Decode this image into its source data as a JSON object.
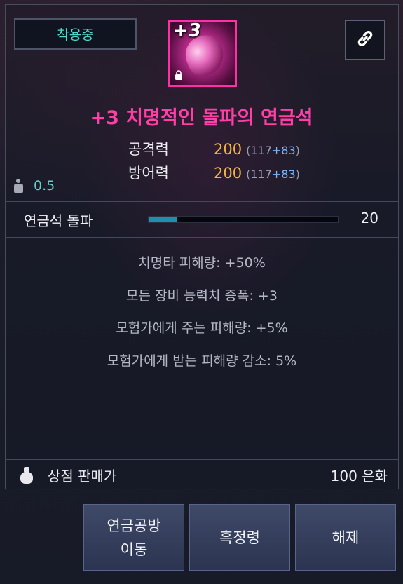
{
  "equip_status": "착용중",
  "item": {
    "enhance_level": "+3",
    "title": "+3 치명적인 돌파의 연금석",
    "rarity_color": "#ff2fa6"
  },
  "icons": {
    "link": "link-icon",
    "lock": "lock-icon",
    "weight": "weight-icon",
    "bag": "money-bag-icon"
  },
  "stats": [
    {
      "label": "공격력",
      "value": "200",
      "base": "117",
      "bonus": "+83"
    },
    {
      "label": "방어력",
      "value": "200",
      "base": "117",
      "bonus": "+83"
    }
  ],
  "weight": "0.5",
  "breakthrough": {
    "label": "연금석 돌파",
    "value": "20",
    "progress_fraction": 0.15
  },
  "effects": [
    "치명타 피해량: +50%",
    "모든 장비 능력치 증폭: +3",
    "모험가에게 주는 피해량: +5%",
    "모험가에게 받는 피해량 감소: 5%"
  ],
  "sell": {
    "label": "상점 판매가",
    "price": "100 은화"
  },
  "buttons": {
    "workshop_line1": "연금공방",
    "workshop_line2": "이동",
    "black_essence": "흑정령",
    "unequip": "해제"
  }
}
